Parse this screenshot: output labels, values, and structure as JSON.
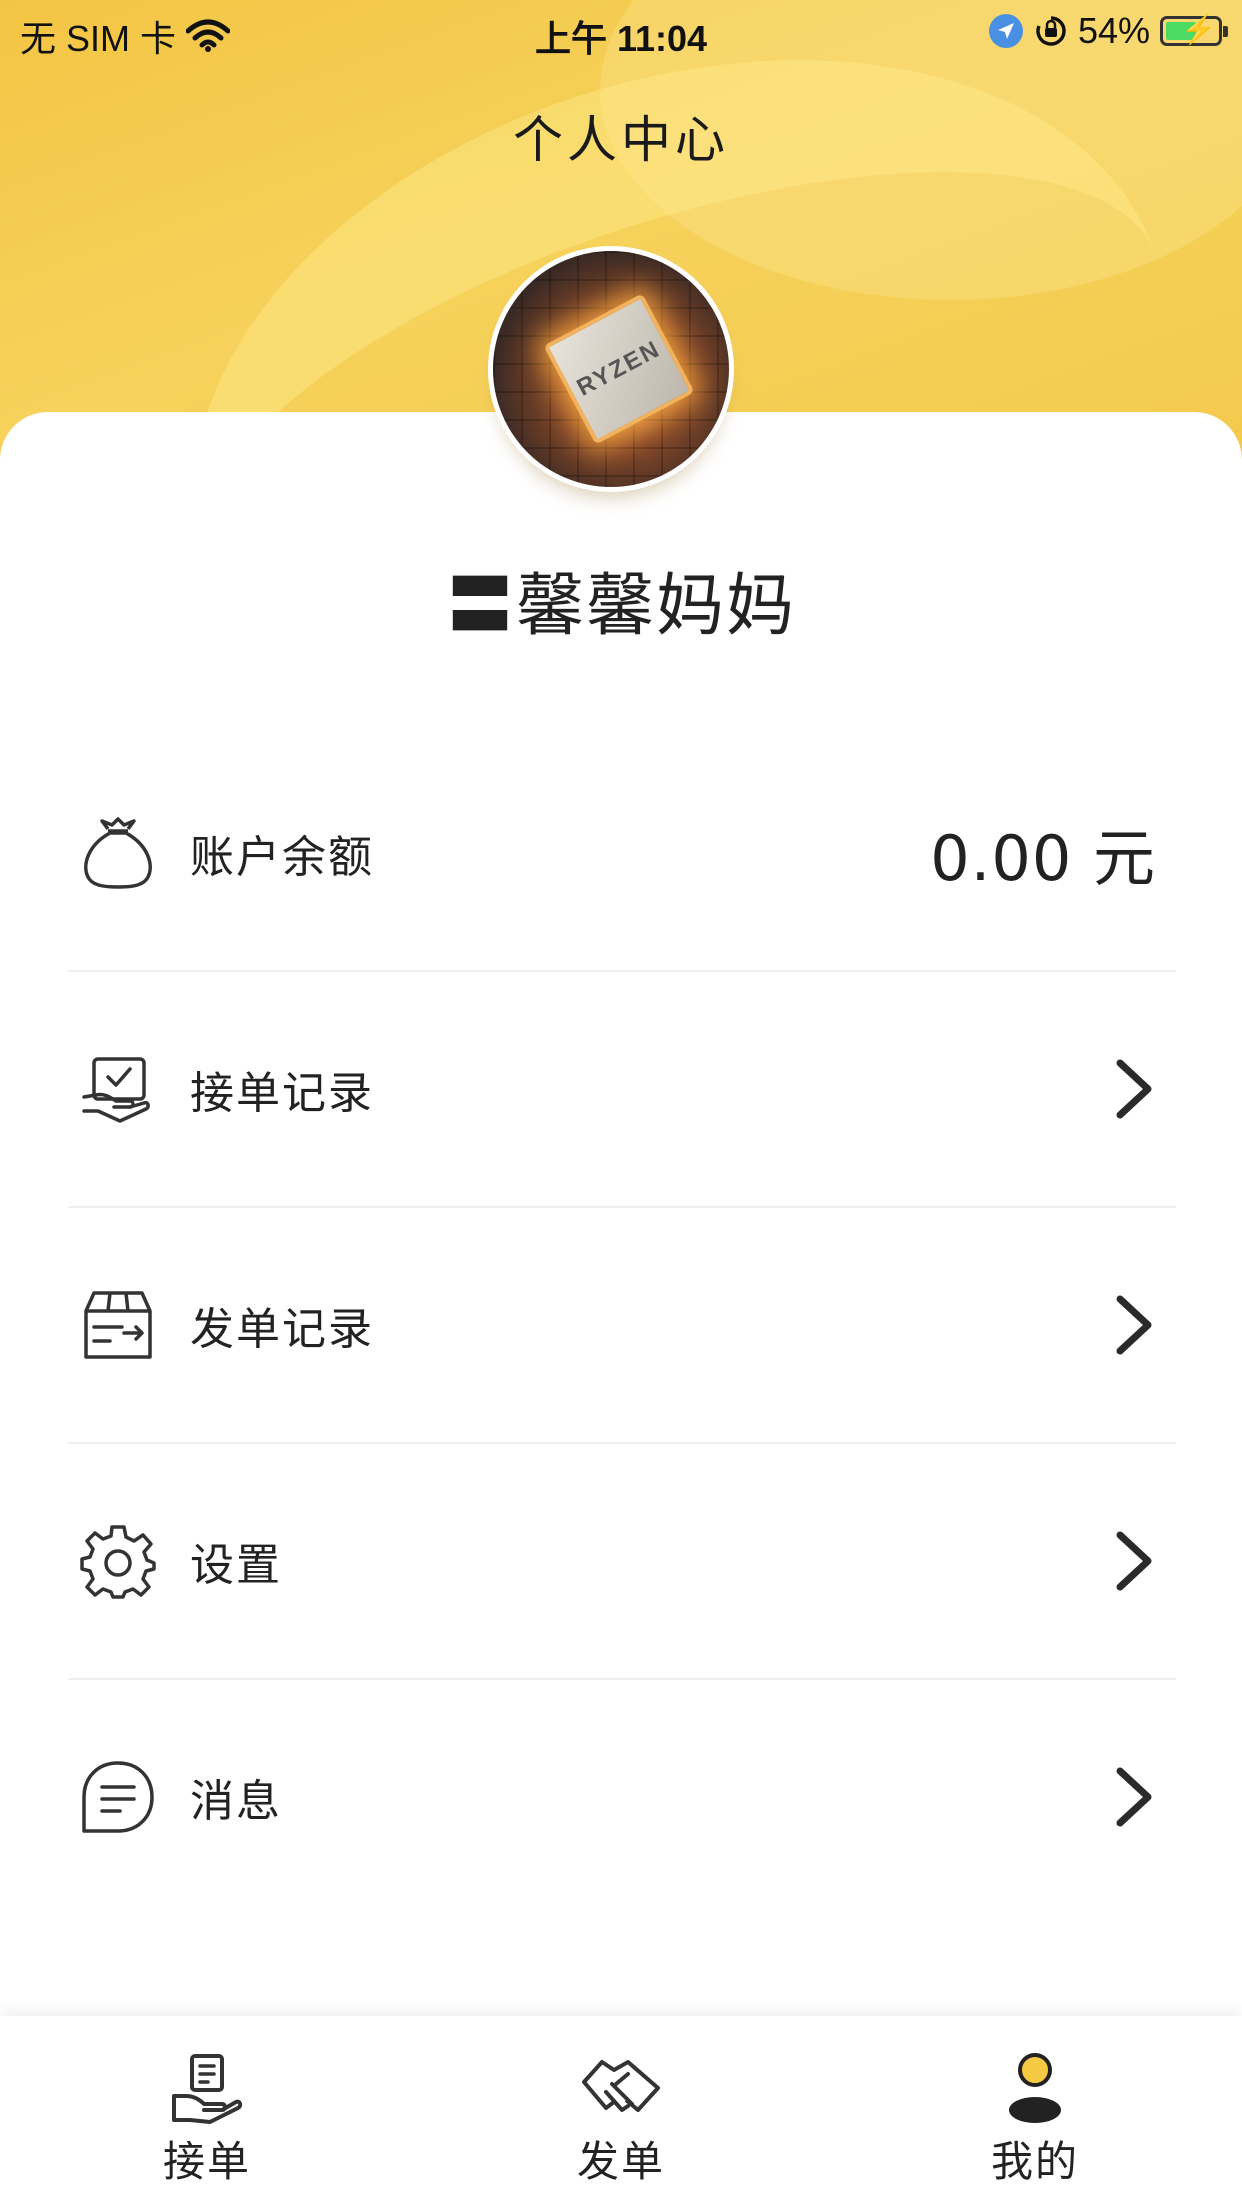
{
  "status_bar": {
    "carrier": "无 SIM 卡",
    "time": "上午 11:04",
    "battery": "54%"
  },
  "header": {
    "title": "个人中心"
  },
  "profile": {
    "name": "〓馨馨妈妈",
    "avatar_text": "RYZEN"
  },
  "menu": {
    "balance": {
      "label": "账户余额",
      "value": "0.00 元"
    },
    "items": [
      {
        "label": "接单记录",
        "icon": "hand-check-icon"
      },
      {
        "label": "发单记录",
        "icon": "delivery-box-icon"
      },
      {
        "label": "设置",
        "icon": "gear-icon"
      },
      {
        "label": "消息",
        "icon": "message-icon"
      }
    ]
  },
  "tabbar": {
    "tabs": [
      {
        "label": "接单",
        "icon": "receive-order-icon"
      },
      {
        "label": "发单",
        "icon": "handshake-icon"
      },
      {
        "label": "我的",
        "icon": "profile-icon",
        "active": true
      }
    ]
  },
  "colors": {
    "accent": "#f5c944",
    "active_tab": "#f5c944",
    "text": "#222222"
  }
}
